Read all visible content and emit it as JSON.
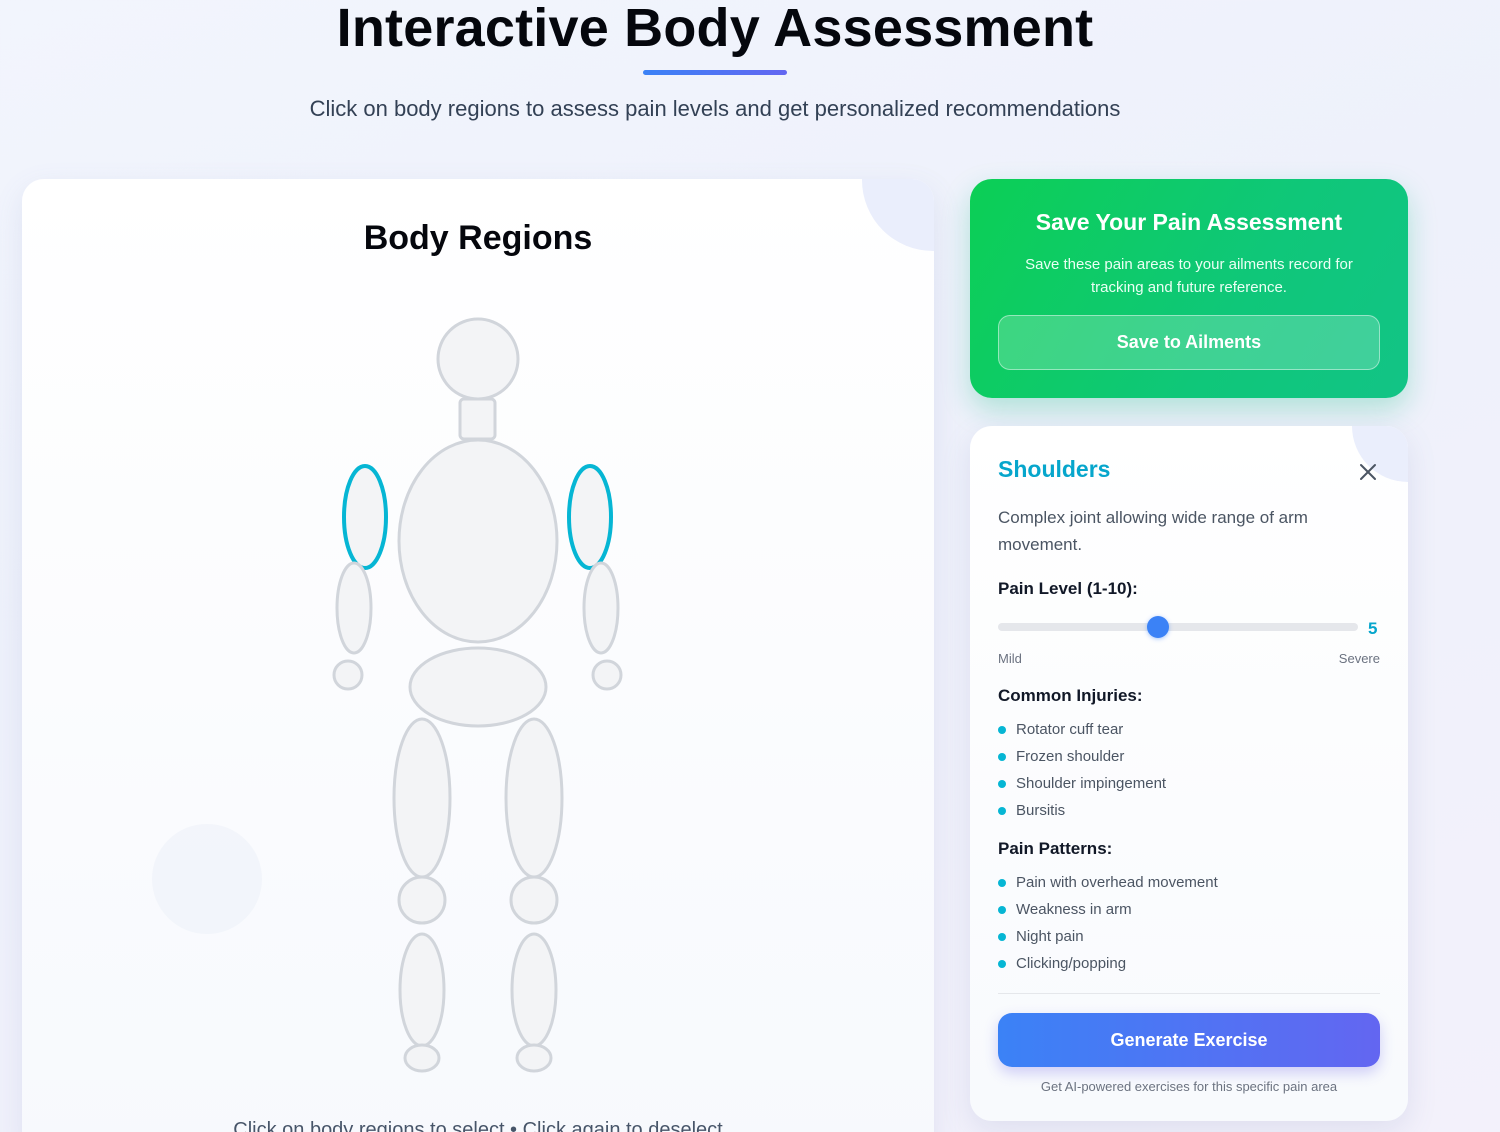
{
  "header": {
    "title": "Interactive Body Assessment",
    "subtitle": "Click on body regions to assess pain levels and get personalized recommendations"
  },
  "body_panel": {
    "title": "Body Regions",
    "hint": "Click on body regions to select • Click again to deselect",
    "selected_region": "shoulders"
  },
  "save_panel": {
    "title": "Save Your Pain Assessment",
    "description": "Save these pain areas to your ailments record for tracking and future reference.",
    "button_label": "Save to Ailments"
  },
  "detail_panel": {
    "region_title": "Shoulders",
    "close_icon": "close-icon",
    "description": "Complex joint allowing wide range of arm movement.",
    "pain_label": "Pain Level (1-10):",
    "pain_value": 5,
    "pain_min": 1,
    "pain_max": 10,
    "scale_min_label": "Mild",
    "scale_max_label": "Severe",
    "injuries_title": "Common Injuries:",
    "injuries": [
      "Rotator cuff tear",
      "Frozen shoulder",
      "Shoulder impingement",
      "Bursitis"
    ],
    "patterns_title": "Pain Patterns:",
    "patterns": [
      "Pain with overhead movement",
      "Weakness in arm",
      "Night pain",
      "Clicking/popping"
    ],
    "generate_label": "Generate Exercise",
    "generate_hint": "Get AI-powered exercises for this specific pain area"
  },
  "colors": {
    "accent": "#06b6d4",
    "primary": "#3b82f6",
    "save_green": "#0ccf55"
  }
}
